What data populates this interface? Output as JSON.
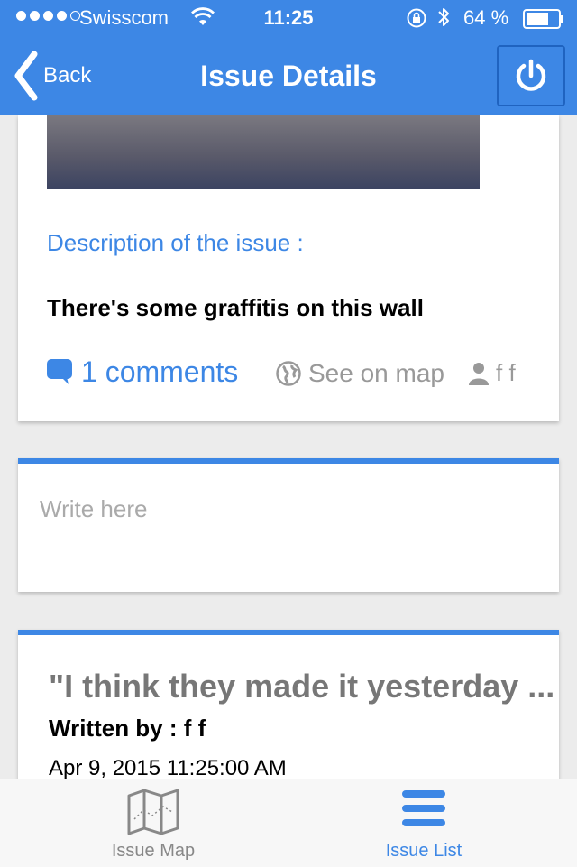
{
  "status_bar": {
    "carrier": "Swisscom",
    "time": "11:25",
    "battery_percent": "64 %",
    "signal_bars_filled": 4,
    "signal_bars_total": 5
  },
  "nav": {
    "back_label": "Back",
    "title": "Issue Details",
    "power_icon": "power-icon"
  },
  "issue": {
    "description_label": "Description of the issue :",
    "description": "There's some graffitis on this wall",
    "comments_count_label": "1 comments",
    "see_on_map_label": "See on map",
    "author": "f f"
  },
  "comment_form": {
    "placeholder": "Write here",
    "value": ""
  },
  "comments": [
    {
      "text": "\"I think they made it yesterday ...",
      "written_by": "Written by : f f",
      "date": "Apr 9, 2015 11:25:00 AM"
    }
  ],
  "tabbar": {
    "tabs": [
      {
        "label": "Issue Map",
        "icon": "map-icon",
        "active": false
      },
      {
        "label": "Issue List",
        "icon": "list-icon",
        "active": true
      }
    ]
  },
  "colors": {
    "accent": "#3d87e5",
    "muted": "#999999"
  }
}
